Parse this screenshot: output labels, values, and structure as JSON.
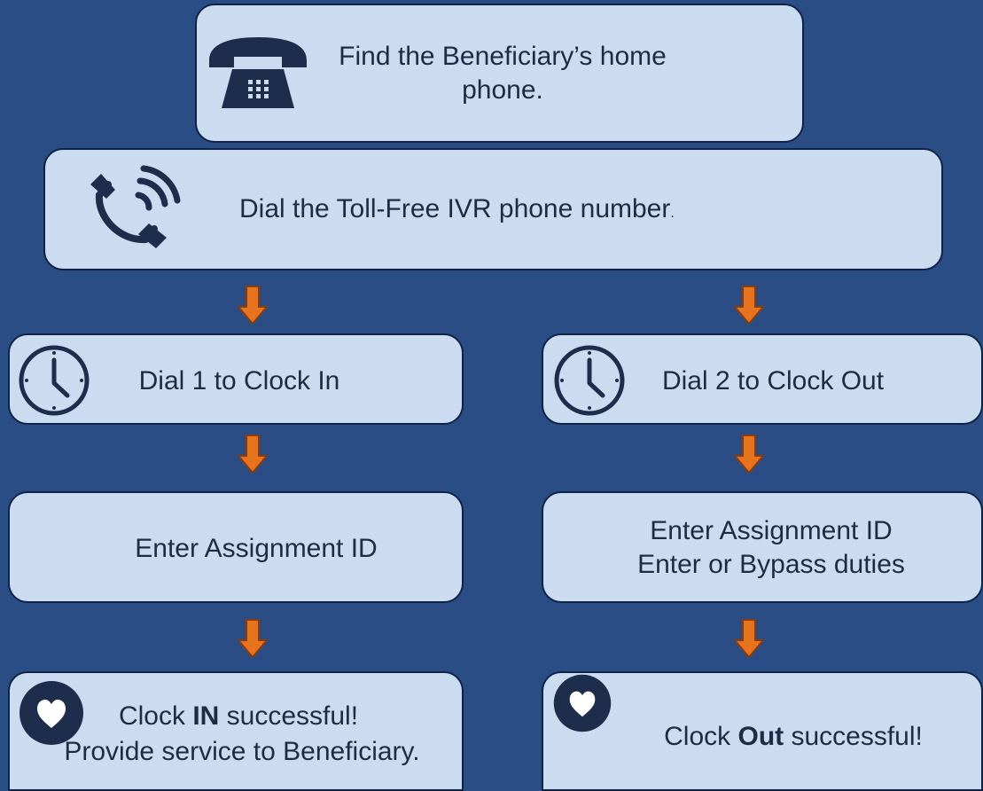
{
  "colors": {
    "background": "#2a4d86",
    "box_fill": "#ccdcf0",
    "box_border": "#0f2347",
    "icon": "#1c2e4c",
    "arrow_fill": "#e8731f",
    "arrow_stroke": "#8a3d0a"
  },
  "steps": {
    "find_phone": {
      "icon": "desk-phone-icon",
      "line1": "Find the Beneficiary’s home",
      "line2": "phone."
    },
    "dial_ivr": {
      "icon": "phone-ringing-icon",
      "text": "Dial the Toll-Free IVR phone number",
      "suffix": "."
    },
    "clock_in": {
      "icon": "clock-icon",
      "text": "Dial 1 to Clock In"
    },
    "clock_out": {
      "icon": "clock-icon",
      "text": "Dial 2 to Clock Out"
    },
    "assign_in": {
      "text": "Enter Assignment ID"
    },
    "assign_out": {
      "line1": "Enter Assignment ID",
      "line2": "Enter or Bypass duties"
    },
    "success_in": {
      "icon": "heart-icon",
      "line1_pre": "Clock ",
      "line1_bold": "IN",
      "line1_post": " successful!",
      "line2": "Provide service to Beneficiary."
    },
    "success_out": {
      "icon": "heart-icon",
      "pre": "Clock ",
      "bold": "Out",
      "post": " successful!"
    }
  }
}
